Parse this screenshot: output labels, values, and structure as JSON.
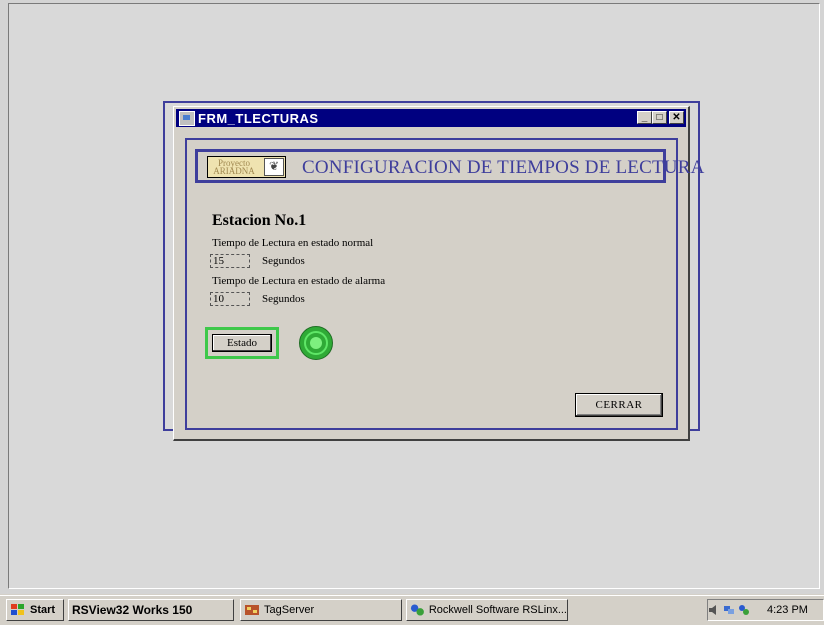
{
  "window": {
    "title": "FRM_TLECTURAS",
    "minimize": "_",
    "maximize": "□",
    "close": "✕"
  },
  "header": {
    "logo_text": "Proyecto ARIADNA",
    "title": "CONFIGURACION DE TIEMPOS DE LECTURA"
  },
  "form": {
    "station": "Estacion No.1",
    "normal_label": "Tiempo de Lectura en estado normal",
    "normal_value": "15",
    "normal_unit": "Segundos",
    "alarm_label": "Tiempo  de Lectura en estado de alarma",
    "alarm_value": "10",
    "alarm_unit": "Segundos",
    "estado_button": "Estado",
    "status_color": "#2faa36",
    "close_button": "CERRAR"
  },
  "taskbar": {
    "start": "Start",
    "items": [
      "RSView32 Works 150",
      "TagServer",
      "Rockwell Software RSLinx..."
    ],
    "clock": "4:23 PM"
  }
}
